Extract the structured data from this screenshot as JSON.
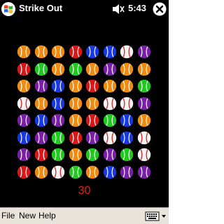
{
  "titlebar": {
    "app_title": "Strike Out",
    "time": "5:43"
  },
  "menubar": {
    "items": [
      "File",
      "New",
      "Help"
    ]
  },
  "game": {
    "score": "30",
    "rows": 8,
    "cols": 8,
    "grid": [
      [
        "orange",
        "orange",
        "orange",
        "red",
        "blue",
        "blue",
        "white",
        "purple"
      ],
      [
        "red",
        "green",
        "orange",
        "green",
        "orange",
        "purple",
        "orange",
        "orange"
      ],
      [
        "orange",
        "purple",
        "blue",
        "orange",
        "red",
        "orange",
        "orange",
        "green"
      ],
      [
        "white",
        "orange",
        "blue",
        "orange",
        "orange",
        "white",
        "white",
        "purple"
      ],
      [
        "purple",
        "blue",
        "purple",
        "orange",
        "red",
        "green",
        "blue",
        "orange"
      ],
      [
        "blue",
        "purple",
        "green",
        "red",
        "purple",
        "white",
        "blue",
        "white"
      ],
      [
        "purple",
        "red",
        "green",
        "orange",
        "green",
        "purple",
        "green",
        "white"
      ],
      [
        "red",
        "orange",
        "white",
        "green",
        "orange",
        "blue",
        "purple",
        "purple"
      ]
    ]
  },
  "colors": {
    "orange": "#f08a10",
    "red": "#d81818",
    "blue": "#1838e0",
    "green": "#20c820",
    "purple": "#7a20a8",
    "white": "#f4f4f4",
    "score": "#e02020",
    "menubar_bg": "#e8e4dc"
  },
  "icons": {
    "start": "windows-flag-icon",
    "volume": "speaker-icon",
    "close": "close-icon",
    "keyboard": "keyboard-icon"
  }
}
